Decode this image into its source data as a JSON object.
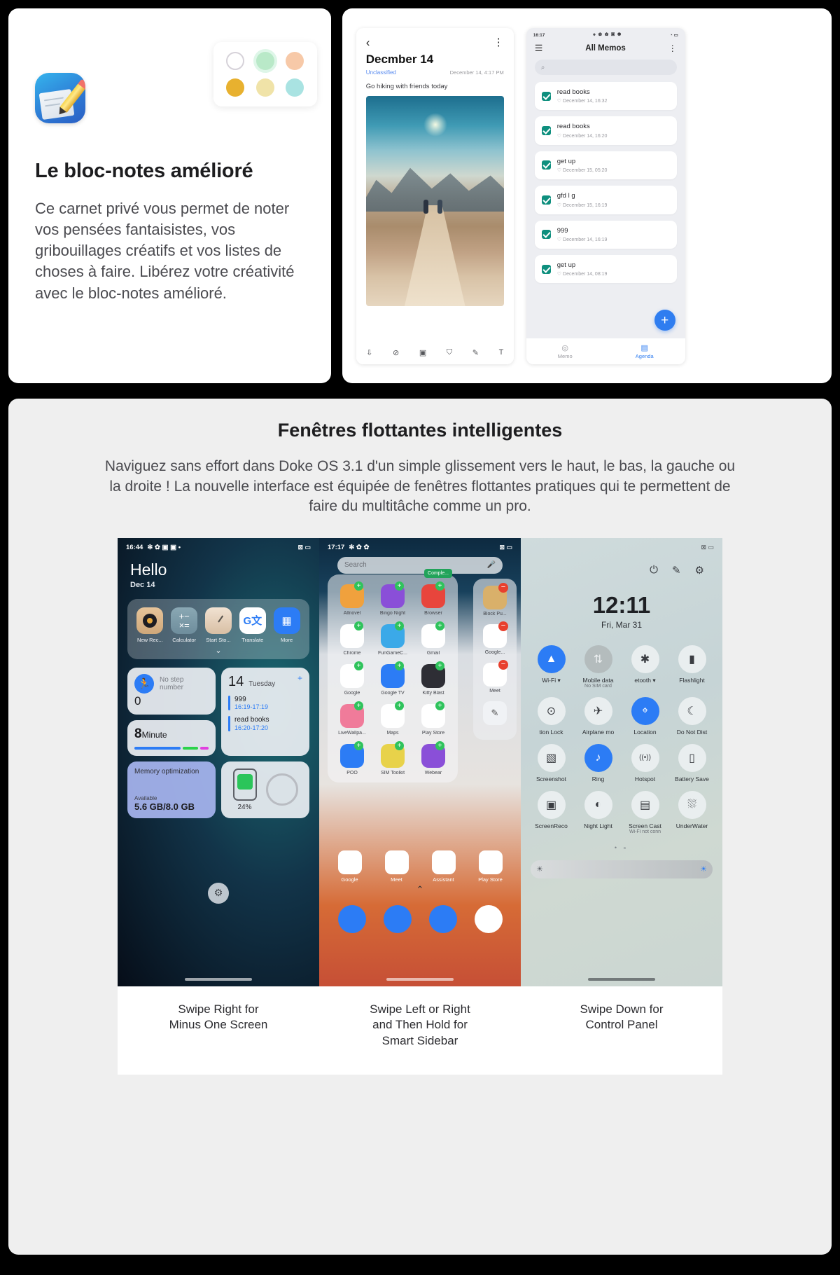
{
  "notes_card": {
    "title": "Le bloc-notes amélioré",
    "body": "Ce carnet privé vous permet de noter vos pensées fantaisistes, vos gribouillages créatifs et vos listes de choses à faire. Libérez votre créativité avec le bloc-notes amélioré.",
    "icon_name": "notes-app-icon",
    "palette": [
      {
        "name": "swatch-white",
        "color": "#ffffff"
      },
      {
        "name": "swatch-green",
        "color": "#b9e9c8"
      },
      {
        "name": "swatch-peach",
        "color": "#f7c9a8"
      },
      {
        "name": "swatch-gold",
        "color": "#e8b12f"
      },
      {
        "name": "swatch-pale-yellow",
        "color": "#f0e3a8"
      },
      {
        "name": "swatch-cyan",
        "color": "#a9e3e2"
      }
    ]
  },
  "note_detail": {
    "back_icon": "‹",
    "menu_icon": "⋮",
    "title": "Decmber 14",
    "tag": "Unclassified",
    "timestamp": "December 14, 4:17 PM",
    "body": "Go hiking with friends today",
    "toolbar": [
      {
        "name": "mic-icon",
        "glyph": "⇩"
      },
      {
        "name": "checklist-icon",
        "glyph": "⊘"
      },
      {
        "name": "image-icon",
        "glyph": "▣"
      },
      {
        "name": "sticker-icon",
        "glyph": "⛉"
      },
      {
        "name": "pen-icon",
        "glyph": "✎"
      },
      {
        "name": "text-icon",
        "glyph": "T"
      }
    ]
  },
  "memos": {
    "status_time": "16:17",
    "status_icons": "⚹ ✿ ✿ ▣ ◉",
    "status_right": "◔ ▭",
    "menu_icon": "☰",
    "title": "All Memos",
    "kebab_icon": "⋮",
    "search_icon": "🔍",
    "search_placeholder": "",
    "fab_label": "+",
    "items": [
      {
        "label": "read books",
        "date": "December 14, 16:32",
        "checked": true
      },
      {
        "label": "read books",
        "date": "December 14, 16:20",
        "checked": true
      },
      {
        "label": "get up",
        "date": "December 15, 05:20",
        "checked": true
      },
      {
        "label": "gfd l g",
        "date": "December 15, 16:19",
        "checked": true
      },
      {
        "label": "999",
        "date": "December 14, 16:19",
        "checked": true
      },
      {
        "label": "get up",
        "date": "December 14, 08:19",
        "checked": true
      }
    ],
    "tabs": [
      {
        "label": "Memo",
        "icon": "◎",
        "active": false
      },
      {
        "label": "Agenda",
        "icon": "▤",
        "active": true
      }
    ]
  },
  "floating": {
    "title": "Fenêtres flottantes intelligentes",
    "subtitle": "Naviguez sans effort dans Doke OS 3.1 d'un simple glissement vers le haut, le bas, la gauche ou la droite ! La nouvelle interface est équipée de fenêtres flottantes pratiques qui te permettent de faire du multitâche comme un pro.",
    "captions": [
      "Swipe Right for\nMinus One Screen",
      "Swipe Left or Right\nand Then Hold for\nSmart Sidebar",
      "Swipe Down for\nControl Panel"
    ]
  },
  "phone_a": {
    "status_time": "16:44",
    "status_icons": "✻ ✿ ▣ ▣ •",
    "status_right": "⊠ ▭",
    "greeting": "Hello",
    "date": "Dec 14",
    "shortcuts": [
      {
        "label": "New Rec...",
        "name": "new-recording-icon"
      },
      {
        "label": "Calculator",
        "name": "calculator-icon"
      },
      {
        "label": "Start Sto...",
        "name": "stopwatch-icon"
      },
      {
        "label": "Translate",
        "name": "translate-icon"
      },
      {
        "label": "More",
        "name": "more-apps-icon"
      }
    ],
    "step_widget": {
      "title": "No step number",
      "value": "0"
    },
    "minute_widget": {
      "value": "8",
      "unit": "Minute"
    },
    "calendar": {
      "day": "14",
      "weekday": "Tuesday",
      "add_icon": "+",
      "events": [
        {
          "title": "999",
          "time": "16:19-17:19"
        },
        {
          "title": "read books",
          "time": "16:20-17:20"
        }
      ]
    },
    "memory": {
      "title": "Memory optimization",
      "label": "Available",
      "value": "5.6 GB/8.0 GB"
    },
    "battery": {
      "percent": "24%"
    },
    "gear_icon": "⚙"
  },
  "phone_b": {
    "status_time": "17:17",
    "status_icons": "✻ ✿ ✿",
    "status_right": "⊠ ▭",
    "search_placeholder": "Search",
    "mic_icon": "🎤",
    "badge": "Comple...",
    "apps": [
      {
        "label": "Allnovel",
        "color": "#f0a13d"
      },
      {
        "label": "Bingo Night",
        "color": "#8a4fd8"
      },
      {
        "label": "Browser",
        "color": "#e8453c"
      },
      {
        "label": "Chrome",
        "color": "#ffffff"
      },
      {
        "label": "FunGameC...",
        "color": "#3ba9e8"
      },
      {
        "label": "Gmail",
        "color": "#ffffff"
      },
      {
        "label": "Google",
        "color": "#ffffff"
      },
      {
        "label": "Google TV",
        "color": "#2c7cf5"
      },
      {
        "label": "Kitty Blast",
        "color": "#2e2e35"
      },
      {
        "label": "LiveWallpa...",
        "color": "#f07b9a"
      },
      {
        "label": "Maps",
        "color": "#ffffff"
      },
      {
        "label": "Play Store",
        "color": "#ffffff"
      },
      {
        "label": "POO",
        "color": "#2c7cf5"
      },
      {
        "label": "SIM Toolkit",
        "color": "#e8d24a"
      },
      {
        "label": "Webear",
        "color": "#8a4fd8"
      }
    ],
    "sidebar": [
      {
        "label": "Block Pu...",
        "color": "#d9b06a"
      },
      {
        "label": "Google...",
        "color": "#ffffff"
      },
      {
        "label": "Meet",
        "color": "#ffffff"
      },
      {
        "label": "",
        "color": "#f0f2f5"
      }
    ],
    "dock_row": [
      {
        "label": "Google",
        "color": "#ffffff"
      },
      {
        "label": "Meet",
        "color": "#ffffff"
      },
      {
        "label": "Assistant",
        "color": "#ffffff"
      },
      {
        "label": "Play Store",
        "color": "#ffffff"
      }
    ],
    "up_chevron": "⌃",
    "bottom_dock": [
      {
        "name": "phone-icon",
        "color": "#2c7cf5"
      },
      {
        "name": "messages-icon",
        "color": "#2c7cf5"
      },
      {
        "name": "browser-icon",
        "color": "#2c7cf5"
      },
      {
        "name": "chrome-icon",
        "color": "#ffffff"
      }
    ]
  },
  "phone_c": {
    "status_right": "⊠ ▭",
    "top_icons": [
      {
        "name": "power-icon",
        "glyph": "⏻"
      },
      {
        "name": "edit-icon",
        "glyph": "✎"
      },
      {
        "name": "settings-icon",
        "glyph": "⚙"
      }
    ],
    "clock": "12:11",
    "date": "Fri, Mar 31",
    "toggles": [
      {
        "label": "Wi-Fi",
        "sublabel": "",
        "icon": "◉",
        "state": "on",
        "caret": true
      },
      {
        "label": "Mobile data",
        "sublabel": "No SIM card",
        "icon": "⇅",
        "state": "off",
        "caret": false
      },
      {
        "label": "etooth",
        "sublabel": "",
        "icon": "✱",
        "state": "off",
        "caret": true
      },
      {
        "label": "Flashlight",
        "sublabel": "",
        "icon": "▮",
        "state": "off",
        "caret": false
      },
      {
        "label": "tion Lock",
        "sublabel": "",
        "icon": "⊙",
        "state": "neutral",
        "caret": false
      },
      {
        "label": "Airplane mo",
        "sublabel": "",
        "icon": "✈",
        "state": "neutral",
        "caret": false
      },
      {
        "label": "Location",
        "sublabel": "",
        "icon": "⌖",
        "state": "on",
        "caret": false
      },
      {
        "label": "Do Not Dist",
        "sublabel": "",
        "icon": "☾",
        "state": "neutral",
        "caret": false
      },
      {
        "label": "Screenshot",
        "sublabel": "",
        "icon": "▧",
        "state": "neutral",
        "caret": false
      },
      {
        "label": "Ring",
        "sublabel": "",
        "icon": "🔔",
        "state": "on",
        "caret": false
      },
      {
        "label": "Hotspot",
        "sublabel": "",
        "icon": "((•))",
        "state": "neutral",
        "caret": false
      },
      {
        "label": "Battery Save",
        "sublabel": "",
        "icon": "▯",
        "state": "neutral",
        "caret": false
      },
      {
        "label": "ScreenReco",
        "sublabel": "",
        "icon": "▣",
        "state": "neutral",
        "caret": false
      },
      {
        "label": "Night Light",
        "sublabel": "",
        "icon": "◐",
        "state": "neutral",
        "caret": false
      },
      {
        "label": "Screen Cast",
        "sublabel": "Wi-Fi not conn",
        "icon": "▤",
        "state": "neutral",
        "caret": false
      },
      {
        "label": "UnderWater",
        "sublabel": "",
        "icon": "⛆",
        "state": "neutral",
        "caret": false
      }
    ],
    "page_dots": "• ∘",
    "brightness": {
      "left_icon": "☀",
      "right_icon": "☀"
    }
  }
}
